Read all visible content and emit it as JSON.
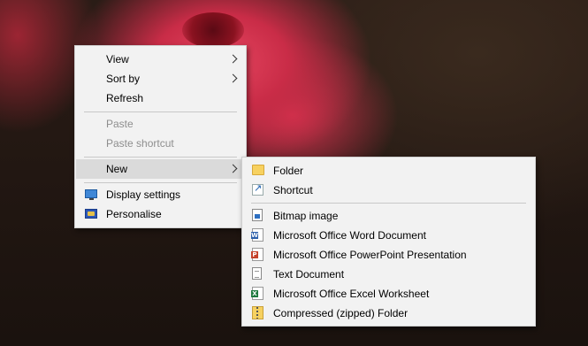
{
  "context_menu": {
    "items": [
      {
        "label": "View",
        "has_submenu": true,
        "enabled": true
      },
      {
        "label": "Sort by",
        "has_submenu": true,
        "enabled": true
      },
      {
        "label": "Refresh",
        "has_submenu": false,
        "enabled": true
      },
      {
        "label": "Paste",
        "has_submenu": false,
        "enabled": false
      },
      {
        "label": "Paste shortcut",
        "has_submenu": false,
        "enabled": false
      },
      {
        "label": "New",
        "has_submenu": true,
        "enabled": true,
        "highlighted": true
      },
      {
        "label": "Display settings",
        "icon": "display-settings-icon",
        "enabled": true
      },
      {
        "label": "Personalise",
        "icon": "personalise-icon",
        "enabled": true
      }
    ]
  },
  "new_submenu": {
    "items": [
      {
        "label": "Folder",
        "icon": "folder-icon"
      },
      {
        "label": "Shortcut",
        "icon": "shortcut-icon"
      },
      {
        "label": "Bitmap image",
        "icon": "bitmap-image-icon"
      },
      {
        "label": "Microsoft Office Word Document",
        "icon": "word-document-icon"
      },
      {
        "label": "Microsoft Office PowerPoint Presentation",
        "icon": "powerpoint-presentation-icon"
      },
      {
        "label": "Text Document",
        "icon": "text-document-icon"
      },
      {
        "label": "Microsoft Office Excel Worksheet",
        "icon": "excel-worksheet-icon"
      },
      {
        "label": "Compressed (zipped) Folder",
        "icon": "zip-folder-icon"
      }
    ]
  },
  "colors": {
    "menu_background": "#f2f2f2",
    "highlight": "#dadada",
    "disabled_text": "#8e8e8e"
  }
}
